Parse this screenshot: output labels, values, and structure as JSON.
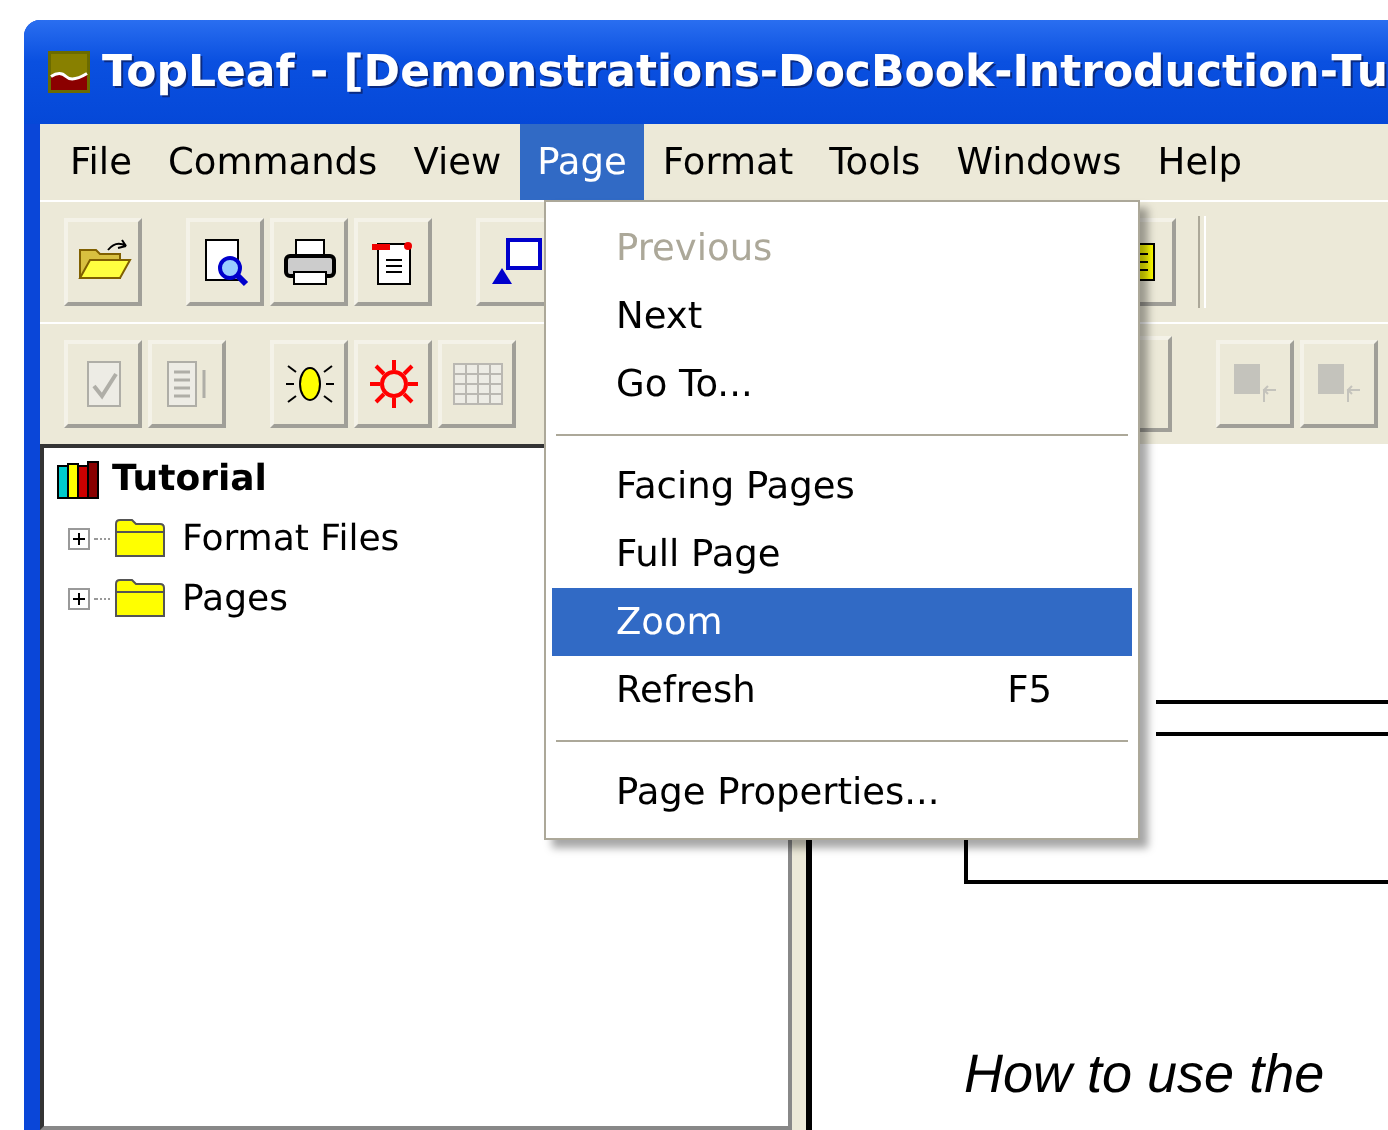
{
  "window": {
    "title": "TopLeaf - [Demonstrations-DocBook-Introduction-Tu"
  },
  "menu_bar": [
    {
      "label": "File",
      "selected": false
    },
    {
      "label": "Commands",
      "selected": false
    },
    {
      "label": "View",
      "selected": false
    },
    {
      "label": "Page",
      "selected": true
    },
    {
      "label": "Format",
      "selected": false
    },
    {
      "label": "Tools",
      "selected": false
    },
    {
      "label": "Windows",
      "selected": false
    },
    {
      "label": "Help",
      "selected": false
    }
  ],
  "toolbar_1": [
    {
      "disabled": false
    },
    {
      "disabled": false
    },
    {
      "disabled": false
    },
    {
      "disabled": false
    },
    {
      "disabled": false
    },
    {
      "disabled": false
    }
  ],
  "toolbar_2": [
    {
      "disabled": true
    },
    {
      "disabled": true
    },
    {
      "disabled": false
    },
    {
      "disabled": false
    },
    {
      "disabled": true
    },
    {
      "disabled": true
    },
    {
      "disabled": true
    }
  ],
  "page_menu": [
    {
      "kind": "item",
      "label": "Previous",
      "disabled": true,
      "selected": false
    },
    {
      "kind": "item",
      "label": "Next",
      "disabled": false,
      "selected": false
    },
    {
      "kind": "item",
      "label": "Go To...",
      "disabled": false,
      "selected": false
    },
    {
      "kind": "separator"
    },
    {
      "kind": "item",
      "label": "Facing Pages",
      "disabled": false,
      "selected": false
    },
    {
      "kind": "item",
      "label": "Full Page",
      "disabled": false,
      "selected": false
    },
    {
      "kind": "item",
      "label": "Zoom",
      "disabled": false,
      "selected": true
    },
    {
      "kind": "item",
      "label": "Refresh",
      "shortcut": "F5",
      "disabled": false,
      "selected": false
    },
    {
      "kind": "separator"
    },
    {
      "kind": "item",
      "label": "Page Properties...",
      "disabled": false,
      "selected": false
    }
  ],
  "tree": {
    "label": "Tutorial",
    "children": [
      {
        "label": "Format Files",
        "expanded": false
      },
      {
        "label": "Pages",
        "expanded": false
      }
    ]
  },
  "document": {
    "text": "How to use the"
  }
}
